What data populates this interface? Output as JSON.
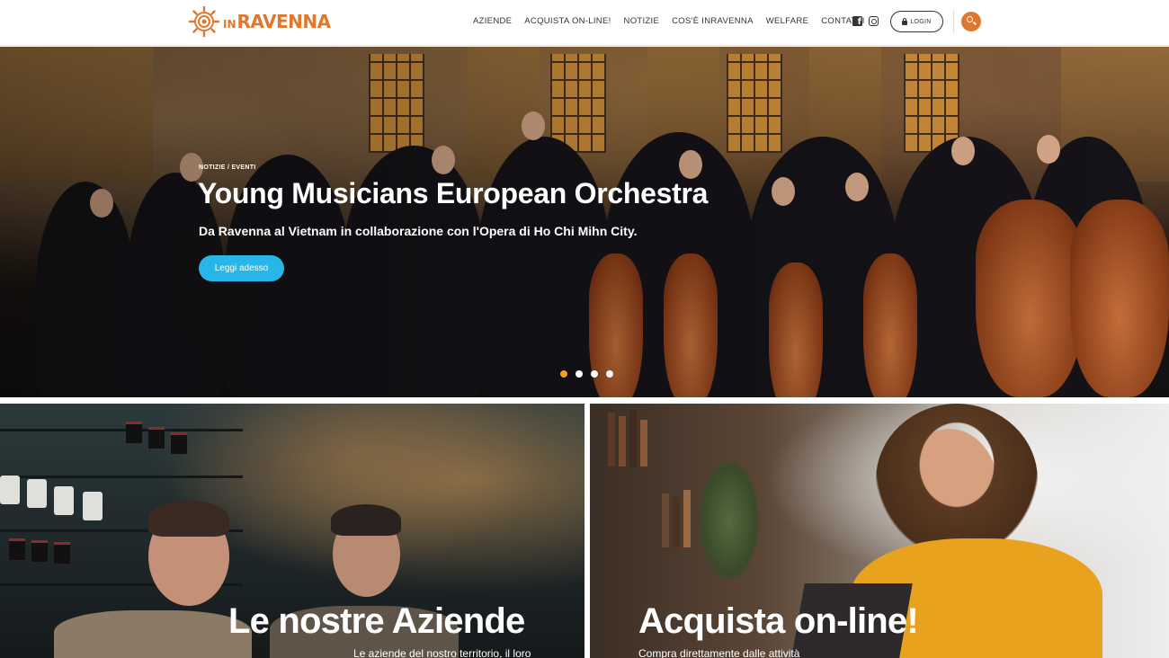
{
  "header": {
    "logo_in": "IN",
    "logo_name": "RAVENNA",
    "nav": [
      "AZIENDE",
      "ACQUISTA ON-LINE!",
      "NOTIZIE",
      "COS'È INRAVENNA",
      "WELFARE",
      "CONTATTI"
    ],
    "login_label": "LOGIN",
    "accent_color": "#e0772d"
  },
  "hero": {
    "category": "NOTIZIE / EVENTI",
    "title": "Young Musicians European Orchestra",
    "subtitle": "Da Ravenna al Vietnam in collaborazione con l'Opera di Ho Chi Mihn City.",
    "button_label": "Leggi adesso",
    "button_color": "#27b6e8",
    "slide_count": 4,
    "active_slide": 1,
    "active_dot_color": "#f2a31d"
  },
  "cards": {
    "left": {
      "title": "Le nostre Aziende",
      "subtitle": "Le aziende del nostro territorio, il loro"
    },
    "right": {
      "title": "Acquista on-line!",
      "subtitle": "Compra direttamente dalle attività"
    }
  }
}
